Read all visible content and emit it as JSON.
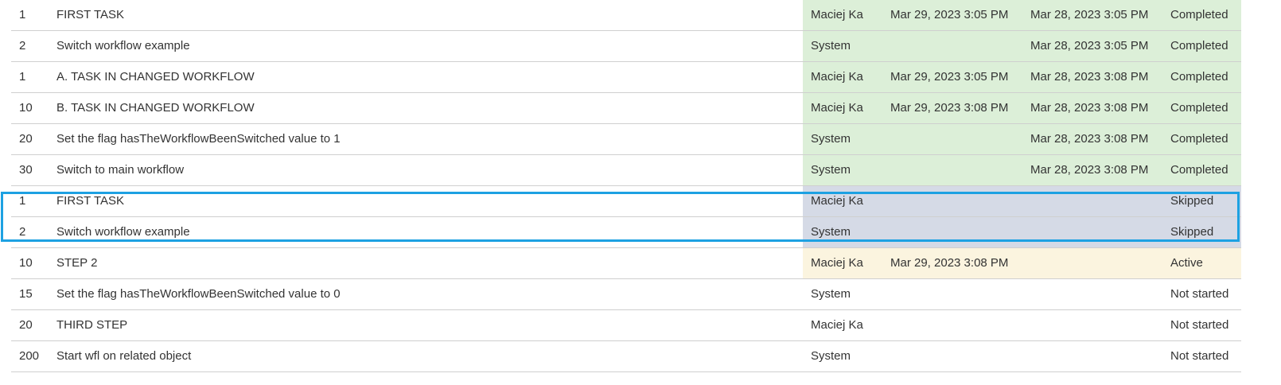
{
  "rows": [
    {
      "num": "1",
      "name": "FIRST TASK",
      "user": "Maciej Ka",
      "due": "Mar 29, 2023 3:05 PM",
      "date": "Mar 28, 2023 3:05 PM",
      "status": "Completed"
    },
    {
      "num": "2",
      "name": "Switch workflow example",
      "user": "System",
      "due": "",
      "date": "Mar 28, 2023 3:05 PM",
      "status": "Completed"
    },
    {
      "num": "1",
      "name": "A. TASK IN CHANGED WORKFLOW",
      "user": "Maciej Ka",
      "due": "Mar 29, 2023 3:05 PM",
      "date": "Mar 28, 2023 3:08 PM",
      "status": "Completed"
    },
    {
      "num": "10",
      "name": "B. TASK IN CHANGED WORKFLOW",
      "user": "Maciej Ka",
      "due": "Mar 29, 2023 3:08 PM",
      "date": "Mar 28, 2023 3:08 PM",
      "status": "Completed"
    },
    {
      "num": "20",
      "name": "Set the flag hasTheWorkflowBeenSwitched value to 1",
      "user": "System",
      "due": "",
      "date": "Mar 28, 2023 3:08 PM",
      "status": "Completed"
    },
    {
      "num": "30",
      "name": "Switch to main workflow",
      "user": "System",
      "due": "",
      "date": "Mar 28, 2023 3:08 PM",
      "status": "Completed"
    },
    {
      "num": "1",
      "name": "FIRST TASK",
      "user": "Maciej Ka",
      "due": "",
      "date": "",
      "status": "Skipped"
    },
    {
      "num": "2",
      "name": "Switch workflow example",
      "user": "System",
      "due": "",
      "date": "",
      "status": "Skipped"
    },
    {
      "num": "10",
      "name": "STEP 2",
      "user": "Maciej Ka",
      "due": "Mar 29, 2023 3:08 PM",
      "date": "",
      "status": "Active"
    },
    {
      "num": "15",
      "name": "Set the flag hasTheWorkflowBeenSwitched value to 0",
      "user": "System",
      "due": "",
      "date": "",
      "status": "Not started"
    },
    {
      "num": "20",
      "name": "THIRD STEP",
      "user": "Maciej Ka",
      "due": "",
      "date": "",
      "status": "Not started"
    },
    {
      "num": "200",
      "name": "Start wfl on related object",
      "user": "System",
      "due": "",
      "date": "",
      "status": "Not started"
    }
  ],
  "colors": {
    "completed": "#dcefd8",
    "skipped": "#d5dae6",
    "active": "#fbf4df",
    "highlight": "#1da1e2"
  }
}
